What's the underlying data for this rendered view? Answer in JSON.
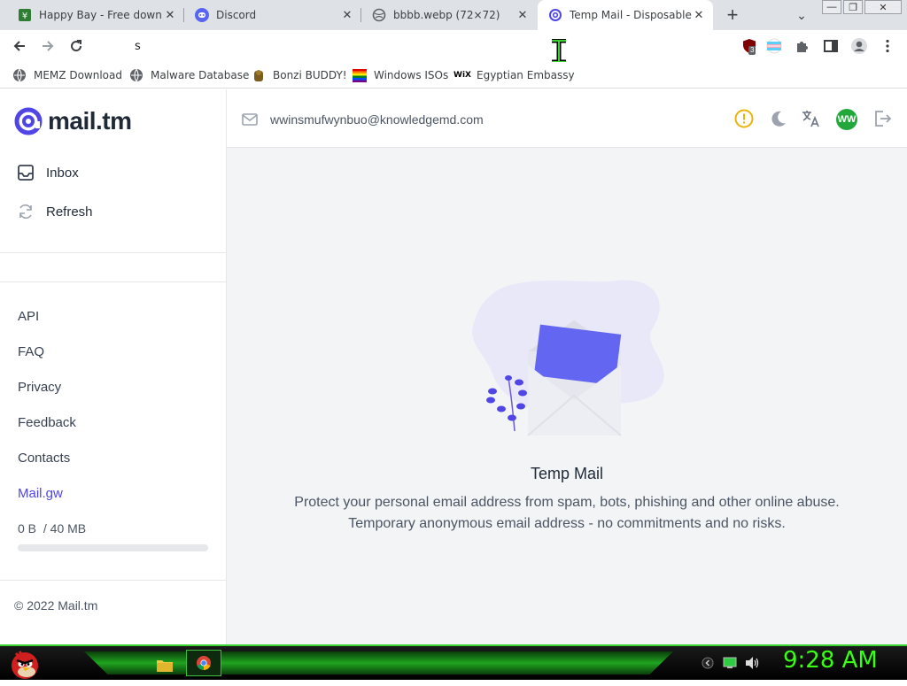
{
  "browser": {
    "tabs": [
      {
        "title": "Happy Bay - Free downlo",
        "icon": "happy-bay-favicon"
      },
      {
        "title": "Discord",
        "icon": "discord-favicon"
      },
      {
        "title": "bbbb.webp (72×72)",
        "icon": "globe-favicon"
      },
      {
        "title": "Temp Mail - Disposable Te",
        "icon": "mailtm-favicon",
        "active": true
      }
    ],
    "new_tab": "+",
    "tab_search": "⌄",
    "window": {
      "minimize": "—",
      "restore": "❐",
      "close": "✕"
    },
    "address_value": "s",
    "extension_badge": "3"
  },
  "bookmarks": [
    {
      "label": "MEMZ Download",
      "icon": "globe-icon"
    },
    {
      "label": "Malware Database",
      "icon": "globe-icon"
    },
    {
      "label": "Bonzi BUDDY!",
      "icon": "bonzi-icon"
    },
    {
      "label": "Windows ISOs",
      "icon": "windows-icon"
    },
    {
      "label": "Egyptian Embassy",
      "icon": "wix-icon"
    }
  ],
  "site": {
    "logo": "mail.tm",
    "email": "wwinsmufwynbuo@knowledgemd.com",
    "avatar": "WW",
    "nav": [
      {
        "label": "Inbox",
        "icon": "inbox-icon"
      },
      {
        "label": "Refresh",
        "icon": "refresh-icon"
      }
    ],
    "links": [
      "API",
      "FAQ",
      "Privacy",
      "Feedback",
      "Contacts",
      "Mail.gw"
    ],
    "storage": {
      "used": "0 B",
      "total": "/ 40 MB",
      "fraction": 0
    },
    "copyright": "© 2022 Mail.tm",
    "empty_title": "Temp Mail",
    "empty_line1": "Protect your personal email address from spam, bots, phishing and other online abuse.",
    "empty_line2": "Temporary anonymous email address - no commitments and no risks."
  },
  "taskbar": {
    "time": "9:28 AM"
  },
  "colors": {
    "brand": "#4f46e5",
    "accent_purple": "#6366f1",
    "clock": "#39ff14",
    "warning": "#eab308",
    "avatar_bg": "#22a83a"
  }
}
